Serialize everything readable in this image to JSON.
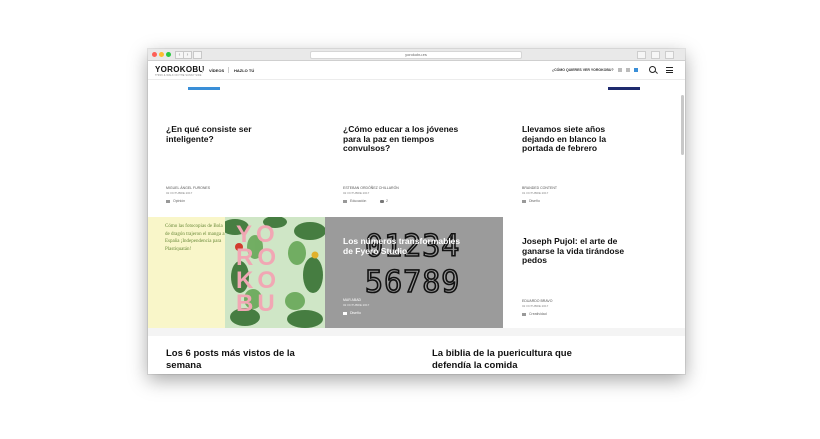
{
  "browser": {
    "url": "yorokobu.es",
    "colors": {
      "close": "#fd5f57",
      "minimize": "#fdbc2e",
      "zoom": "#28c840"
    }
  },
  "header": {
    "logo": "YOROKOBU",
    "tagline": "THINK & WALK ON THE SUNNY SIDE",
    "nav": [
      "VÍDEOS",
      "HAZLO TÚ"
    ],
    "ask": "¿CÓMO QUIERES VER YOROKOBU?"
  },
  "articles": [
    {
      "title": "¿En qué consiste ser inteligente?",
      "author": "MIGUEL ÁNGEL FURONES",
      "date": "02 OCTUBRE 2017",
      "tag": "Opinión"
    },
    {
      "title": "¿Cómo educar a los jóvenes para la paz en tiempos convulsos?",
      "author": "ESTEBAN ORDÓÑEZ CHILLARÓN",
      "date": "02 OCTUBRE 2017",
      "tag": "Educación",
      "comments": "2"
    },
    {
      "title": "Llevamos siete años dejando en blanco la portada de febrero",
      "author": "BRANDED CONTENT",
      "date": "01 OCTUBRE 2017",
      "tag": "Diseño"
    }
  ],
  "quote_card": {
    "text": "Cómo las fotocopias de Bola de dragón trajeron el manga a España ¡Independencia para Plastiquatán!",
    "logo_letters": [
      "Y",
      "O",
      "R",
      "O",
      "K",
      "O",
      "B",
      "U"
    ]
  },
  "fyero_card": {
    "title": "Los números transformables de Fyero Studio",
    "author": "MAR ABAD",
    "date": "02 OCTUBRE 2017",
    "tag": "Diseño",
    "digits_row1": [
      "0",
      "1",
      "2",
      "3",
      "4"
    ],
    "digits_row2": [
      "5",
      "6",
      "7",
      "8",
      "9"
    ]
  },
  "pujol_card": {
    "title": "Joseph Pujol: el arte de ganarse la vida tirándose pedos",
    "author": "EDUARDO BRAVO",
    "date": "02 OCTUBRE 2017",
    "tag": "Creatividad"
  },
  "sections": {
    "left": "Los 6 posts más vistos de la semana",
    "right": "La biblia de la puericultura que defendía la comida"
  },
  "colors": {
    "accent_blue": "#3a8fd8",
    "navy": "#1e2a6e"
  }
}
